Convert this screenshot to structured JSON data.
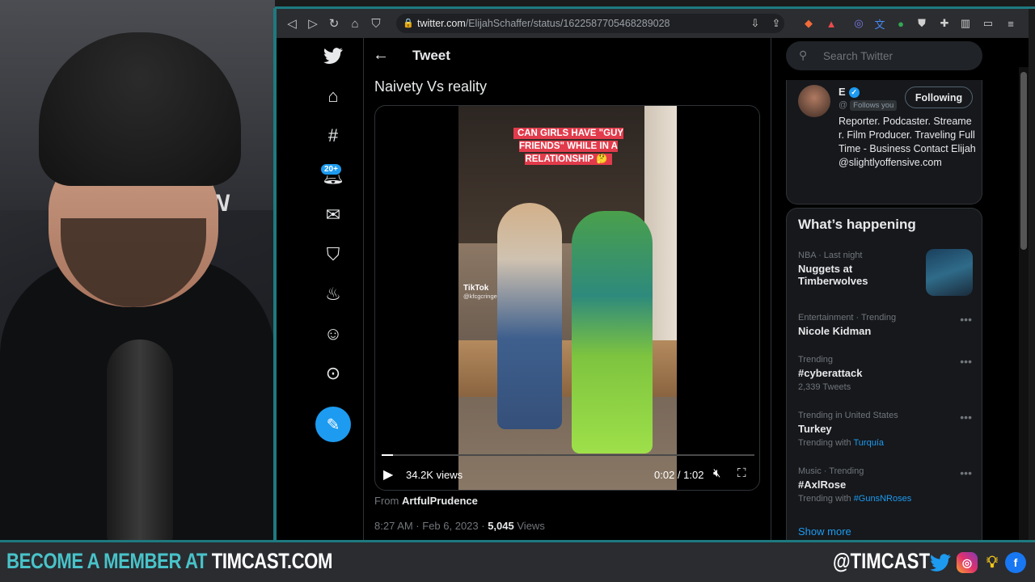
{
  "browser": {
    "url_host": "twitter.com",
    "url_path": "/ElijahSchaffer/status/1622587705468289028"
  },
  "nav": {
    "notifications_badge": "20+"
  },
  "tweet": {
    "header": "Tweet",
    "text": "Naivety Vs reality",
    "video_caption": "CAN GIRLS HAVE \"GUY FRIENDS\" WHILE IN A RELATIONSHIP 🤔",
    "watermark": "TikTok",
    "watermark_handle": "@kfcgcringe",
    "views": "34.2K views",
    "current_time": "0:02",
    "duration": "1:02",
    "from_label": "From",
    "from_account": "ArtfulPrudence",
    "timestamp": "8:27 AM · Feb 6, 2023 ·",
    "view_count": "5,045",
    "views_label": "Views",
    "progress": 0.03
  },
  "sidebar": {
    "search_placeholder": "Search Twitter",
    "profile": {
      "name": "E",
      "handle": "@",
      "follows_you": "Follows you",
      "following_label": "Following",
      "bio": "Reporter. Podcaster. Streamer. Film Producer. Traveling Full Time - Business Contact Elijah@slightlyoffensive.com"
    },
    "whats_happening": "What’s happening",
    "trends": [
      {
        "context": "NBA · Last night",
        "name": "Nuggets at Timberwolves",
        "sub": ""
      },
      {
        "context": "Entertainment · Trending",
        "name": "Nicole Kidman",
        "sub": ""
      },
      {
        "context": "Trending",
        "name": "#cyberattack",
        "sub": "2,339 Tweets"
      },
      {
        "context": "Trending in United States",
        "name": "Turkey",
        "sub_prefix": "Trending with",
        "sub_link": "Turquía"
      },
      {
        "context": "Music · Trending",
        "name": "#AxlRose",
        "sub_prefix": "Trending with",
        "sub_link": "#GunsNRoses"
      }
    ],
    "show_more": "Show more"
  },
  "overlay": {
    "promo_prefix": "BECOME A MEMBER AT",
    "promo_site": "TIMCAST.COM",
    "handle": "@TIMCAST"
  },
  "colors": {
    "accent": "#1d9bf0",
    "frame": "#1e7a80",
    "promo": "#48c3c9"
  }
}
